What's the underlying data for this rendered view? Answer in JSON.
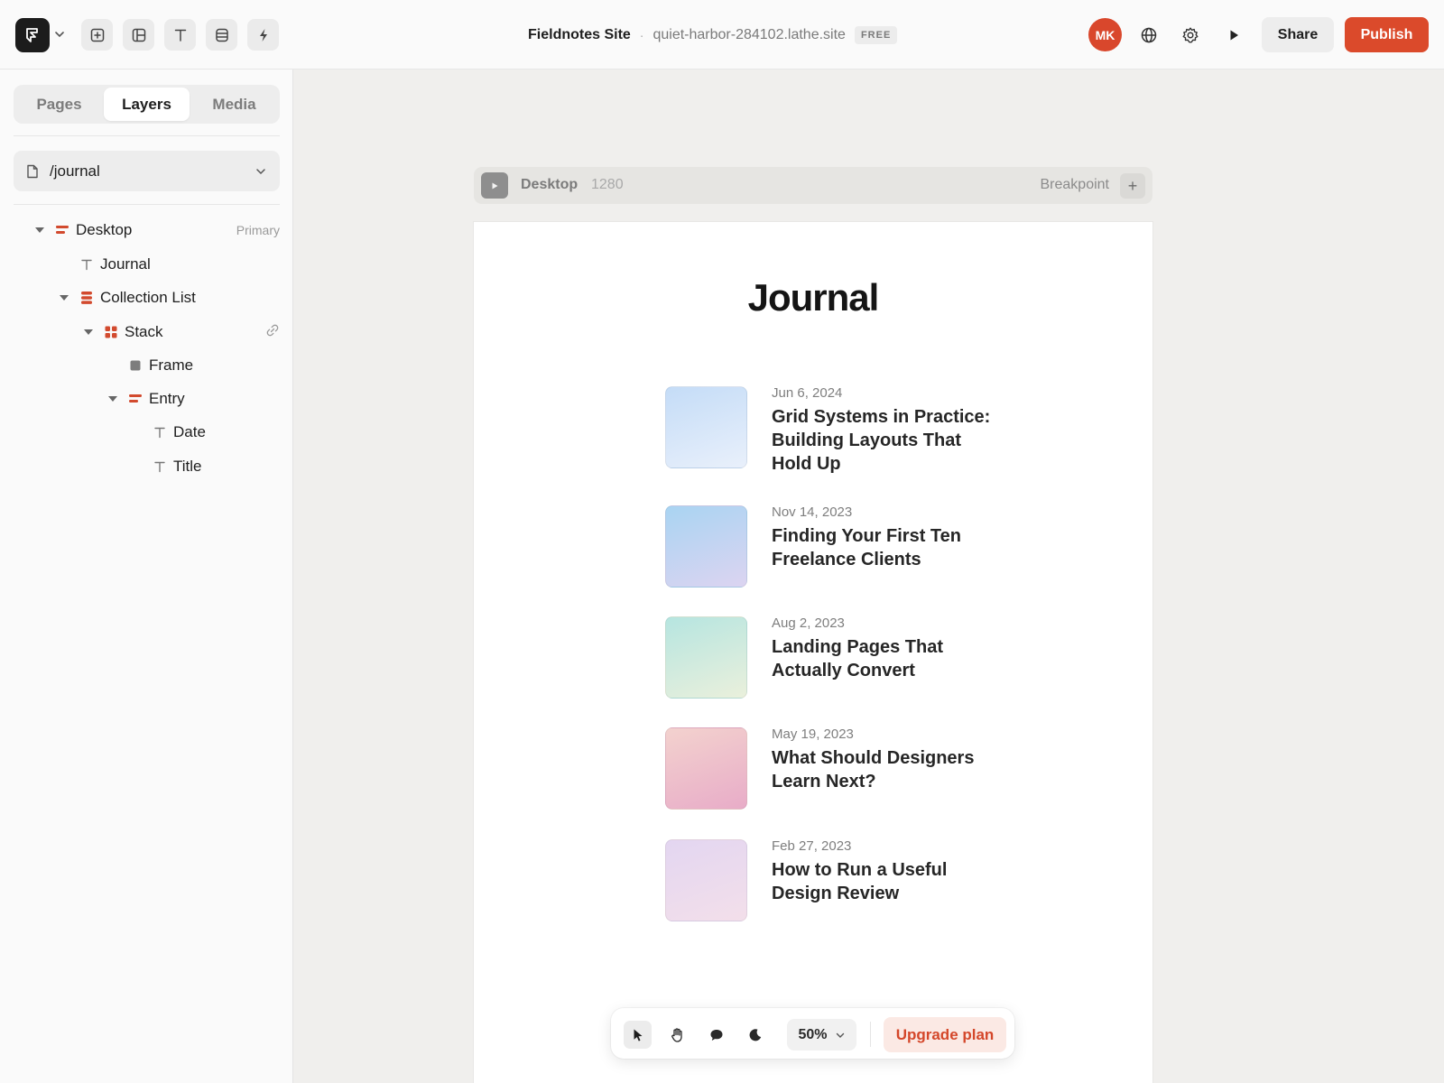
{
  "header": {
    "site_name": "Fieldnotes Site",
    "separator": "·",
    "site_url": "quiet-harbor-284102.lathe.site",
    "plan_badge": "FREE",
    "avatar_initials": "MK",
    "share_label": "Share",
    "publish_label": "Publish",
    "accent_color": "#db4a2b",
    "tools": [
      "add-icon",
      "layout-icon",
      "text-icon",
      "database-icon",
      "bolt-icon"
    ]
  },
  "sidebar": {
    "tabs": [
      {
        "label": "Pages",
        "active": false
      },
      {
        "label": "Layers",
        "active": true
      },
      {
        "label": "Media",
        "active": false
      }
    ],
    "page_select": "/journal",
    "layers": [
      {
        "label": "Desktop",
        "icon": "frame-layer-icon",
        "meta": "Primary",
        "expanded": true
      },
      {
        "label": "Journal",
        "icon": "text-layer-icon"
      },
      {
        "label": "Collection List",
        "icon": "collection-layer-icon",
        "expanded": true
      },
      {
        "label": "Stack",
        "icon": "stack-layer-icon",
        "expanded": true,
        "linked": true
      },
      {
        "label": "Frame",
        "icon": "rectangle-layer-icon"
      },
      {
        "label": "Entry",
        "icon": "frame-layer-icon",
        "expanded": true
      },
      {
        "label": "Date",
        "icon": "text-layer-icon"
      },
      {
        "label": "Title",
        "icon": "text-layer-icon"
      }
    ]
  },
  "canvas": {
    "breakpoint": {
      "label": "Desktop",
      "width": "1280",
      "add_label": "Breakpoint",
      "plus": "+"
    },
    "frame": {
      "title": "Journal",
      "entries": [
        {
          "date": "Jun 6, 2024",
          "title": "Grid Systems in Practice: Building Layouts That Hold Up",
          "colors": [
            "#c4dcf7",
            "#e9f0fb"
          ]
        },
        {
          "date": "Nov 14, 2023",
          "title": "Finding Your First Ten Freelance Clients",
          "colors": [
            "#a9d4f2",
            "#dcd4f1"
          ]
        },
        {
          "date": "Aug 2, 2023",
          "title": "Landing Pages That Actually Convert",
          "colors": [
            "#b6e5e0",
            "#eaf0dc"
          ]
        },
        {
          "date": "May 19, 2023",
          "title": "What Should Designers Learn Next?",
          "colors": [
            "#f3d2ce",
            "#e8acc8"
          ]
        },
        {
          "date": "Feb 27, 2023",
          "title": "How to Run a Useful Design Review",
          "colors": [
            "#e3d6f1",
            "#f3dfea"
          ]
        }
      ]
    }
  },
  "toolbar": {
    "tools": [
      "pointer-icon",
      "hand-icon",
      "comment-icon",
      "theme-icon"
    ],
    "zoom": "50%",
    "upgrade_label": "Upgrade plan"
  }
}
